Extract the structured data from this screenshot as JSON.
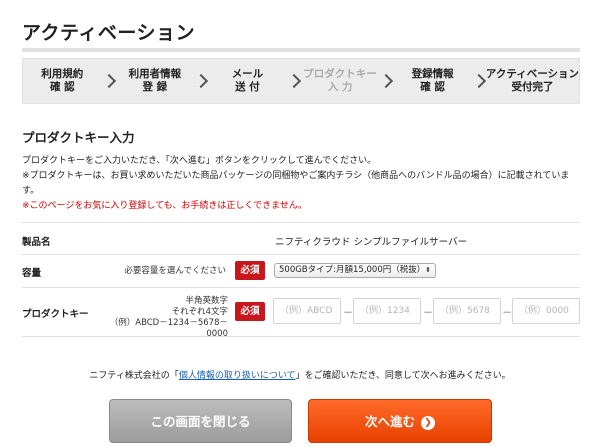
{
  "page": {
    "title": "アクティベーション"
  },
  "steps": [
    {
      "line1": "利用規約",
      "line2": "確 認"
    },
    {
      "line1": "利用者情報",
      "line2": "登 録"
    },
    {
      "line1": "メール",
      "line2": "送 付"
    },
    {
      "line1": "プロダクトキー",
      "line2": "入 力"
    },
    {
      "line1": "登録情報",
      "line2": "確 認"
    },
    {
      "line1": "アクティベーション",
      "line2": "受付完了"
    }
  ],
  "section": {
    "title": "プロダクトキー入力",
    "desc1": "プロダクトキーをご入力いただき、「次へ進む」ボタンをクリックして進んでください。",
    "desc2": "※プロダクトキーは、お買い求めいただいた商品パッケージの同梱物やご案内チラシ（他商品へのバンドル品の場合）に記載されています。",
    "warning": "※このページをお気に入り登録しても、お手続きは正しくできません。"
  },
  "form": {
    "product_label": "製品名",
    "product_value": "ニフティクラウド シンプルファイルサーバー",
    "capacity_label": "容量",
    "capacity_hint": "必要容量を選んでください",
    "required_label": "必須",
    "capacity_value": "500GBタイプ:月額15,000円（税抜）",
    "key_label": "プロダクトキー",
    "key_hint_line1": "半角英数字",
    "key_hint_line2": "それぞれ4文字",
    "key_hint_line3": "（例）ABCD－1234－5678－0000",
    "key_placeholders": [
      "（例）ABCD",
      "（例）1234",
      "（例）5678",
      "（例）0000"
    ],
    "dash": "－"
  },
  "privacy": {
    "prefix": "ニフティ株式会社の「",
    "link": "個人情報の取り扱いについて",
    "suffix": "」をご確認いただき、同意して次へお進みください。"
  },
  "buttons": {
    "close": "この画面を閉じる",
    "next": "次へ進む",
    "next_icon": "❯"
  }
}
